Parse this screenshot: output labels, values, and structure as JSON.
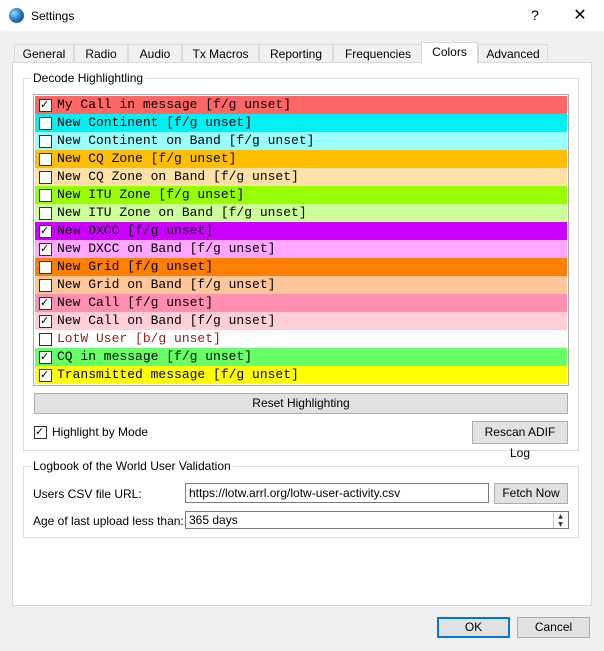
{
  "window": {
    "title": "Settings",
    "help_glyph": "?",
    "close_glyph": "✕"
  },
  "tabs": [
    {
      "label": "General"
    },
    {
      "label": "Radio"
    },
    {
      "label": "Audio"
    },
    {
      "label": "Tx Macros"
    },
    {
      "label": "Reporting"
    },
    {
      "label": "Frequencies"
    },
    {
      "label": "Colors"
    },
    {
      "label": "Advanced"
    }
  ],
  "active_tab": "Colors",
  "decode": {
    "title": "Decode Highlightling",
    "items": [
      {
        "label": "My Call in message [f/g unset]",
        "checked": true,
        "bg": "#ff6666",
        "fg": "#000000"
      },
      {
        "label": "New Continent [f/g unset]",
        "checked": false,
        "bg": "#00f0f4",
        "fg": "#000000"
      },
      {
        "label": "New Continent on Band [f/g unset]",
        "checked": false,
        "bg": "#99ffff",
        "fg": "#000000"
      },
      {
        "label": "New CQ Zone [f/g unset]",
        "checked": false,
        "bg": "#ffbe00",
        "fg": "#000000"
      },
      {
        "label": "New CQ Zone on Band [f/g unset]",
        "checked": false,
        "bg": "#ffe0a6",
        "fg": "#000000"
      },
      {
        "label": "New ITU Zone [f/g unset]",
        "checked": false,
        "bg": "#99ff00",
        "fg": "#000000"
      },
      {
        "label": "New ITU Zone on Band [f/g unset]",
        "checked": false,
        "bg": "#ccff99",
        "fg": "#000000"
      },
      {
        "label": "New DXCC [f/g unset]",
        "checked": true,
        "bg": "#cc00ff",
        "fg": "#000000"
      },
      {
        "label": "New DXCC on Band [f/g unset]",
        "checked": true,
        "bg": "#ffa6ff",
        "fg": "#000000"
      },
      {
        "label": "New Grid [f/g unset]",
        "checked": false,
        "bg": "#ff8000",
        "fg": "#000000"
      },
      {
        "label": "New Grid on Band [f/g unset]",
        "checked": false,
        "bg": "#ffc799",
        "fg": "#000000"
      },
      {
        "label": "New Call [f/g unset]",
        "checked": true,
        "bg": "#ff8fb0",
        "fg": "#000000"
      },
      {
        "label": "New Call on Band [f/g unset]",
        "checked": true,
        "bg": "#ffcfd8",
        "fg": "#000000"
      },
      {
        "label": "LotW User [b/g unset]",
        "checked": false,
        "bg": "#ffffff",
        "fg": "#9e1a1a"
      },
      {
        "label": "CQ in message [f/g unset]",
        "checked": true,
        "bg": "#66ff66",
        "fg": "#000000"
      },
      {
        "label": "Transmitted message [f/g unset]",
        "checked": true,
        "bg": "#ffff00",
        "fg": "#000000"
      }
    ],
    "reset_label": "Reset Highlighting",
    "highlight_by_mode_label": "Highlight by Mode",
    "highlight_by_mode_checked": true,
    "rescan_label": "Rescan ADIF Log"
  },
  "lotw": {
    "title": "Logbook of the World User Validation",
    "csv_label": "Users CSV file URL:",
    "csv_value": "https://lotw.arrl.org/lotw-user-activity.csv",
    "fetch_label": "Fetch Now",
    "age_label": "Age of last upload less than:",
    "age_value": "365 days"
  },
  "footer": {
    "ok_label": "OK",
    "cancel_label": "Cancel"
  }
}
